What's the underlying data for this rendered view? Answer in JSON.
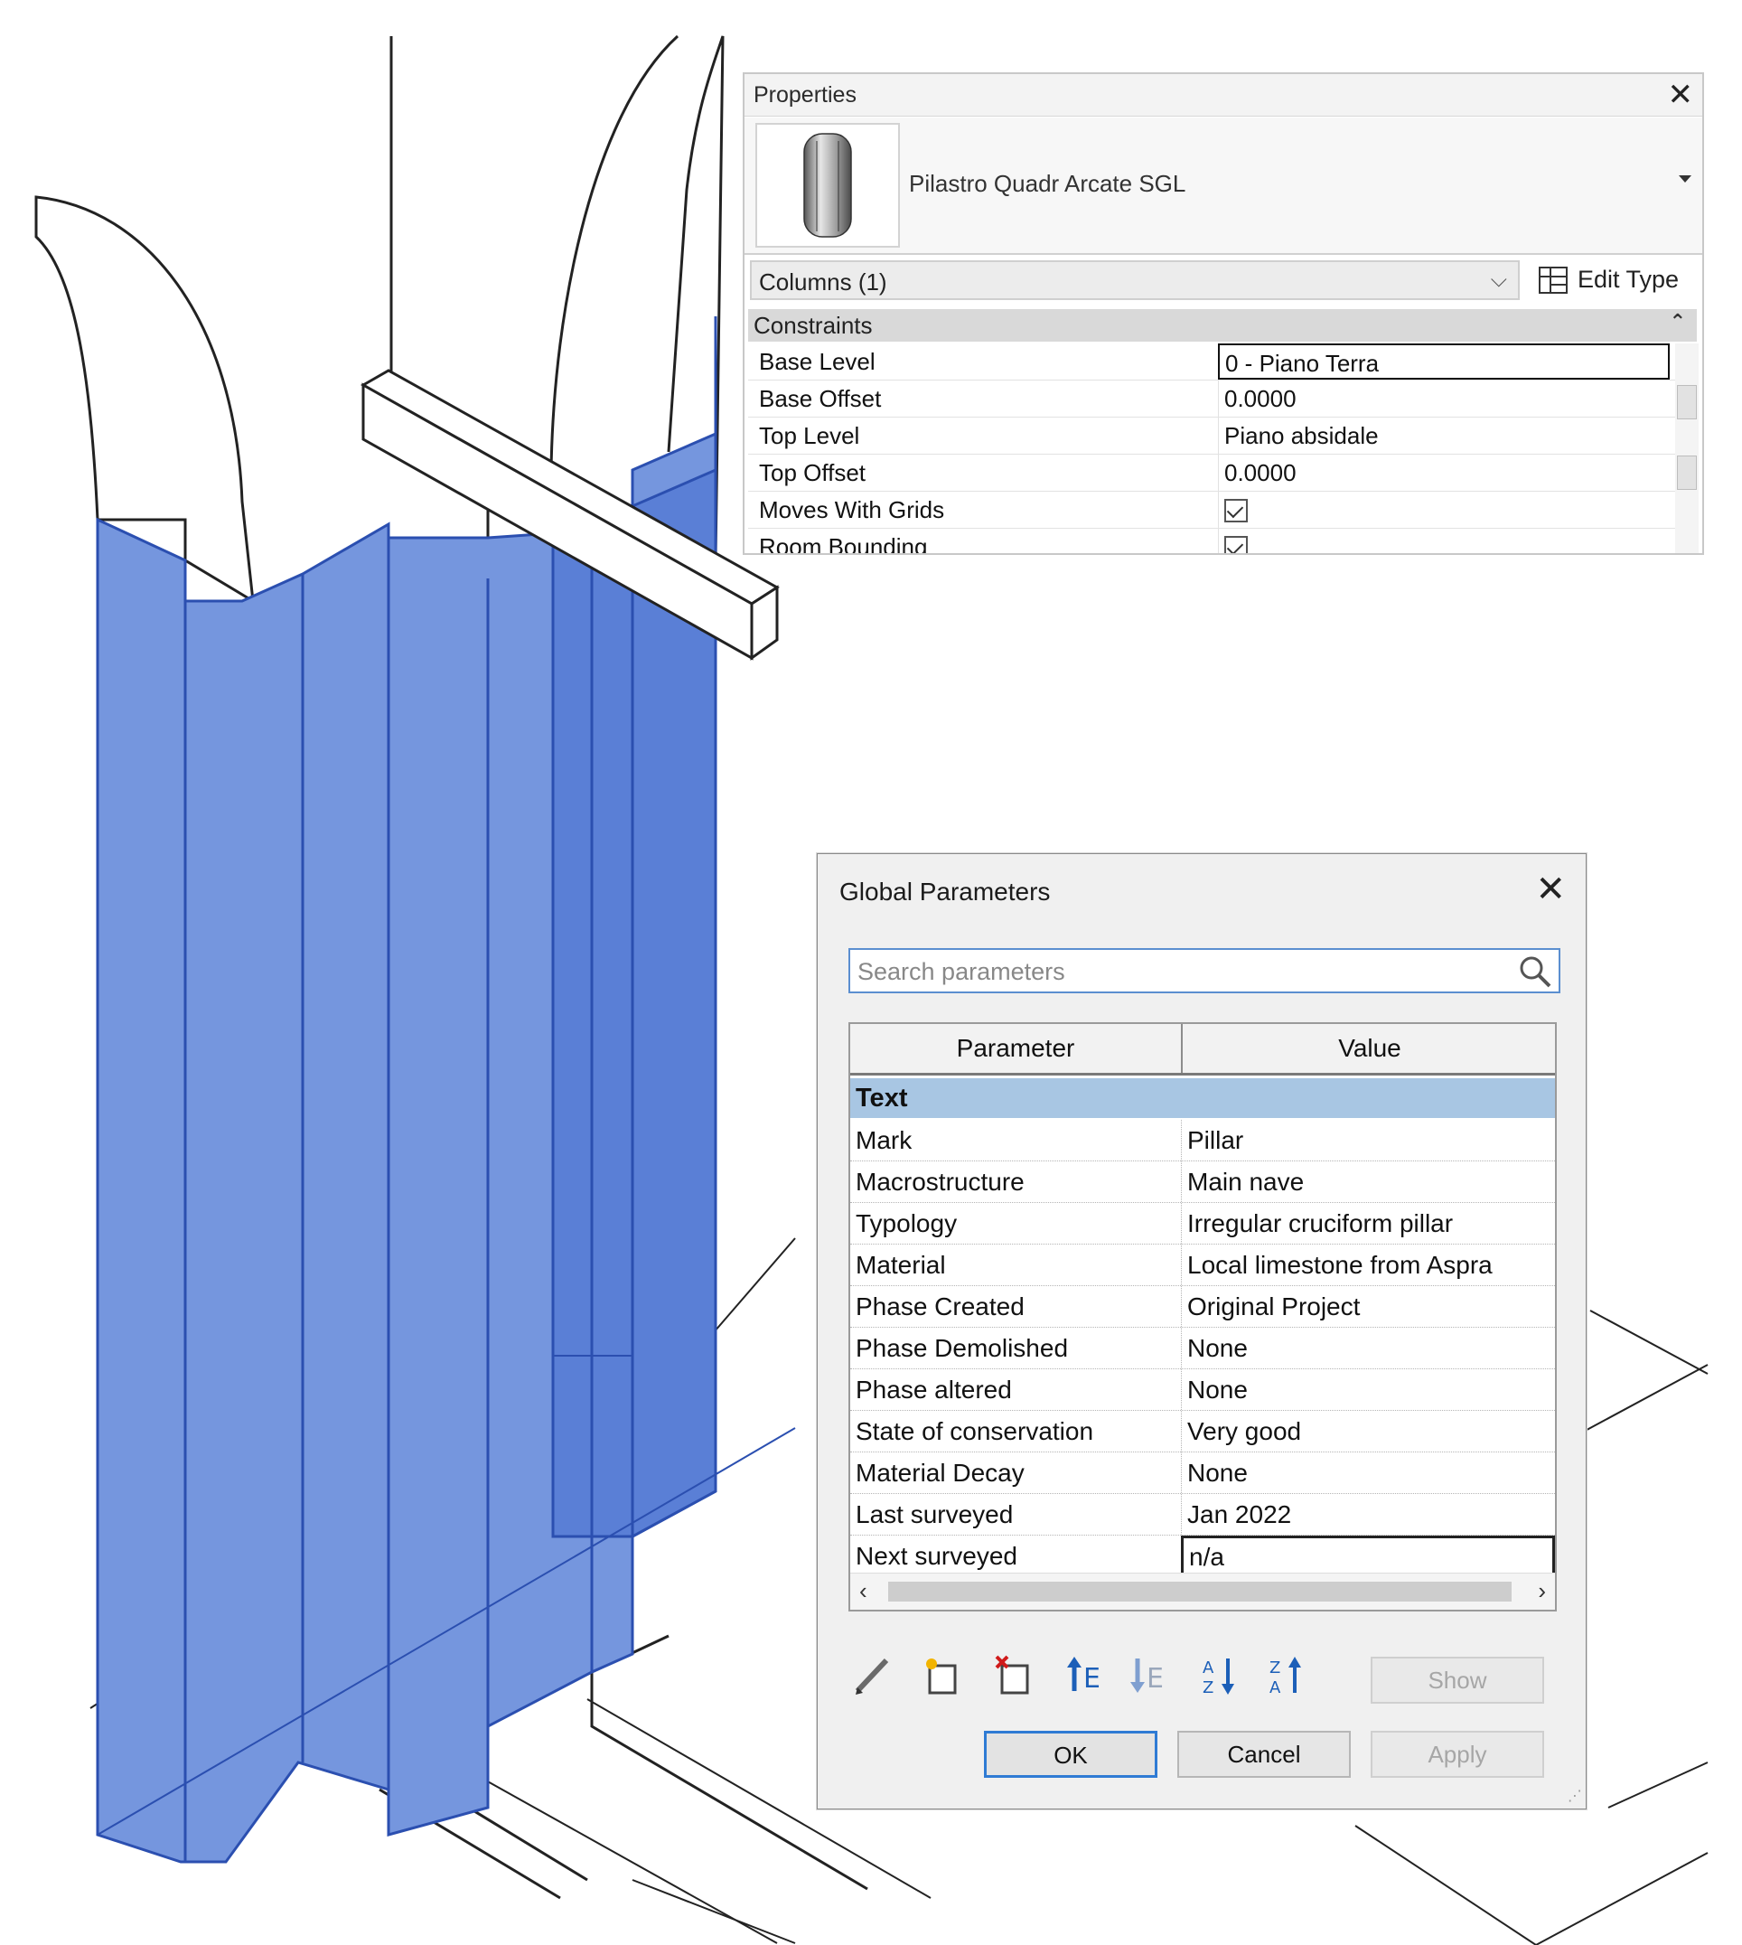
{
  "properties": {
    "title": "Properties",
    "type_name": "Pilastro Quadr Arcate SGL",
    "filter_label": "Columns (1)",
    "edit_type_label": "Edit Type",
    "category": "Constraints",
    "rows": [
      {
        "label": "Base Level",
        "value": "0 - Piano Terra"
      },
      {
        "label": "Base Offset",
        "value": "0.0000"
      },
      {
        "label": "Top Level",
        "value": "Piano absidale"
      },
      {
        "label": "Top Offset",
        "value": "0.0000"
      },
      {
        "label": "Moves With Grids",
        "value": "checked"
      },
      {
        "label": "Room Bounding",
        "value": "checked"
      }
    ]
  },
  "global_parameters": {
    "title": "Global Parameters",
    "search_placeholder": "Search parameters",
    "header_parameter": "Parameter",
    "header_value": "Value",
    "group": "Text",
    "rows": [
      {
        "label": "Mark",
        "value": "Pillar"
      },
      {
        "label": "Macrostructure",
        "value": "Main nave"
      },
      {
        "label": "Typology",
        "value": "Irregular cruciform pillar"
      },
      {
        "label": "Material",
        "value": "Local limestone from Aspra"
      },
      {
        "label": "Phase Created",
        "value": "Original Project"
      },
      {
        "label": "Phase Demolished",
        "value": "None"
      },
      {
        "label": "Phase altered",
        "value": "None"
      },
      {
        "label": "State of conservation",
        "value": "Very good"
      },
      {
        "label": "Material Decay",
        "value": "None"
      },
      {
        "label": "Last surveyed",
        "value": "Jan 2022"
      },
      {
        "label": "Next surveyed",
        "value": "n/a"
      }
    ],
    "buttons": {
      "show": "Show",
      "ok": "OK",
      "cancel": "Cancel",
      "apply": "Apply"
    },
    "tool_icons": [
      "edit-pencil-icon",
      "new-parameter-icon",
      "delete-parameter-icon",
      "move-up-icon",
      "move-down-icon",
      "sort-ascending-icon",
      "sort-descending-icon"
    ]
  },
  "colors": {
    "selection_blue": "#6f95e0",
    "selection_edge": "#2b4fb0",
    "group_header": "#a8c6e3"
  }
}
